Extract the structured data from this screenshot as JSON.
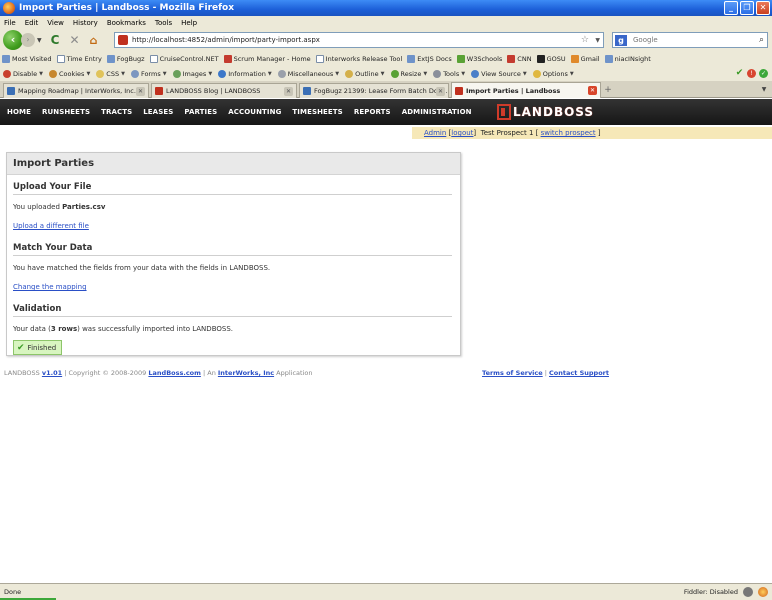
{
  "window": {
    "title": "Import Parties | Landboss - Mozilla Firefox",
    "buttons": [
      "minimize",
      "maximize",
      "close"
    ]
  },
  "menubar": [
    "File",
    "Edit",
    "View",
    "History",
    "Bookmarks",
    "Tools",
    "Help"
  ],
  "navbar": {
    "url": "http://localhost:4852/admin/import/party-import.aspx",
    "search_placeholder": "Google"
  },
  "bookmarks": [
    {
      "label": "Most Visited",
      "icon": "bookmark-icon"
    },
    {
      "label": "Time Entry",
      "icon": "page-icon"
    },
    {
      "label": "FogBugz",
      "icon": "fogbugz-icon"
    },
    {
      "label": "CruiseControl.NET",
      "icon": "page-icon"
    },
    {
      "label": "Scrum Manager - Home",
      "icon": "scrum-icon"
    },
    {
      "label": "Interworks Release Tool",
      "icon": "page-icon"
    },
    {
      "label": "ExtJS Docs",
      "icon": "extjs-icon"
    },
    {
      "label": "W3Schools",
      "icon": "w3schools-icon"
    },
    {
      "label": "CNN",
      "icon": "cnn-icon"
    },
    {
      "label": "GOSU",
      "icon": "gosu-icon"
    },
    {
      "label": "Gmail",
      "icon": "gmail-icon"
    },
    {
      "label": "niacINsight",
      "icon": "wordpress-icon"
    }
  ],
  "webdev_toolbar": [
    "Disable",
    "Cookies",
    "CSS",
    "Forms",
    "Images",
    "Information",
    "Miscellaneous",
    "Outline",
    "Resize",
    "Tools",
    "View Source",
    "Options"
  ],
  "tabs": [
    {
      "label": "Mapping Roadmap | InterWorks, Inc.",
      "active": false
    },
    {
      "label": "LANDBOSS Blog | LANDBOSS",
      "active": false
    },
    {
      "label": "FogBugz 21399: Lease Form Batch Doc...",
      "active": false
    },
    {
      "label": "Import Parties | Landboss",
      "active": true
    }
  ],
  "app_nav": [
    "HOME",
    "RUNSHEETS",
    "TRACTS",
    "LEASES",
    "PARTIES",
    "ACCOUNTING",
    "TIMESHEETS",
    "REPORTS",
    "ADMINISTRATION"
  ],
  "logo_text": "LANDBOSS",
  "userbar": {
    "user": "Admin",
    "logout": "logout",
    "prospect": "Test Prospect 1",
    "switch": "switch prospect"
  },
  "panel": {
    "title": "Import Parties",
    "upload": {
      "heading": "Upload Your File",
      "text_prefix": "You uploaded ",
      "file": "Parties.csv",
      "link": "Upload a different file"
    },
    "match": {
      "heading": "Match Your Data",
      "text": "You have matched the fields from your data with the fields in LANDBOSS.",
      "link": "Change the mapping"
    },
    "validation": {
      "heading": "Validation",
      "text_prefix": "Your data (",
      "rows": "3 rows",
      "text_suffix": ") was successfully imported into LANDBOSS.",
      "button": "Finished"
    }
  },
  "footer": {
    "brand": "LANDBOSS",
    "version": "v1.01",
    "copyright": " | Copyright © 2008-2009 ",
    "site": "LandBoss.com",
    "an": " | An ",
    "company": "InterWorks, Inc",
    "app": " Application",
    "terms": "Terms of Service",
    "sep": " | ",
    "contact": "Contact Support"
  },
  "statusbar": {
    "text": "Done",
    "fiddler": "Fiddler: Disabled"
  }
}
